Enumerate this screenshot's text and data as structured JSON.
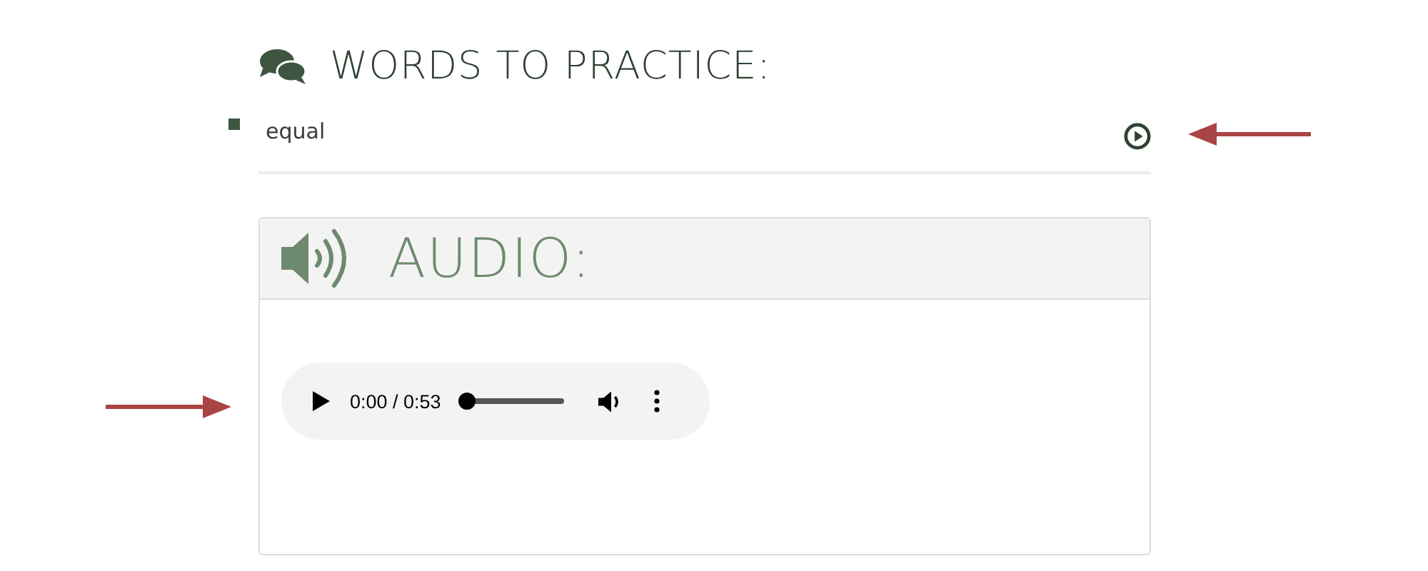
{
  "words_section": {
    "title": "WORDS TO PRACTICE:",
    "words": [
      {
        "text": "equal"
      }
    ]
  },
  "audio_section": {
    "title": "AUDIO:",
    "player": {
      "time": "0:00 / 0:53",
      "level": 0
    }
  }
}
